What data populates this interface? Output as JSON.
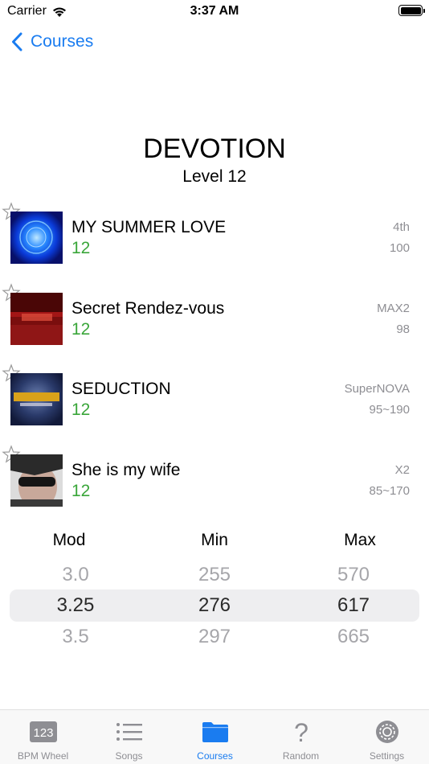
{
  "status_bar": {
    "carrier": "Carrier",
    "time": "3:37 AM"
  },
  "nav": {
    "back_label": "Courses"
  },
  "course": {
    "title": "DEVOTION",
    "level": "Level 12"
  },
  "songs": [
    {
      "title": "MY SUMMER LOVE",
      "level": "12",
      "version": "4th",
      "bpm": "100",
      "jacket": "blue-orb-jacket"
    },
    {
      "title": "Secret Rendez-vous",
      "level": "12",
      "version": "MAX2",
      "bpm": "98",
      "jacket": "red-stage-jacket"
    },
    {
      "title": "SEDUCTION",
      "level": "12",
      "version": "SuperNOVA",
      "bpm": "95~190",
      "jacket": "seduction-logo-jacket"
    },
    {
      "title": "She is my wife",
      "level": "12",
      "version": "X2",
      "bpm": "85~170",
      "jacket": "sunglasses-face-jacket"
    }
  ],
  "picker": {
    "headers": {
      "mod": "Mod",
      "min": "Min",
      "max": "Max"
    },
    "mod": {
      "above": "3.0",
      "selected": "3.25",
      "below": "3.5"
    },
    "min": {
      "above": "255",
      "selected": "276",
      "below": "297"
    },
    "max": {
      "above": "570",
      "selected": "617",
      "below": "665"
    }
  },
  "tabs": [
    {
      "label": "BPM Wheel",
      "icon": "number-pad-icon"
    },
    {
      "label": "Songs",
      "icon": "list-icon"
    },
    {
      "label": "Courses",
      "icon": "folder-icon",
      "active": true
    },
    {
      "label": "Random",
      "icon": "question-mark-icon"
    },
    {
      "label": "Settings",
      "icon": "gear-icon"
    }
  ],
  "colors": {
    "accent": "#1a7cf0",
    "level_green": "#3aa63a",
    "secondary_text": "#8e8e93"
  }
}
